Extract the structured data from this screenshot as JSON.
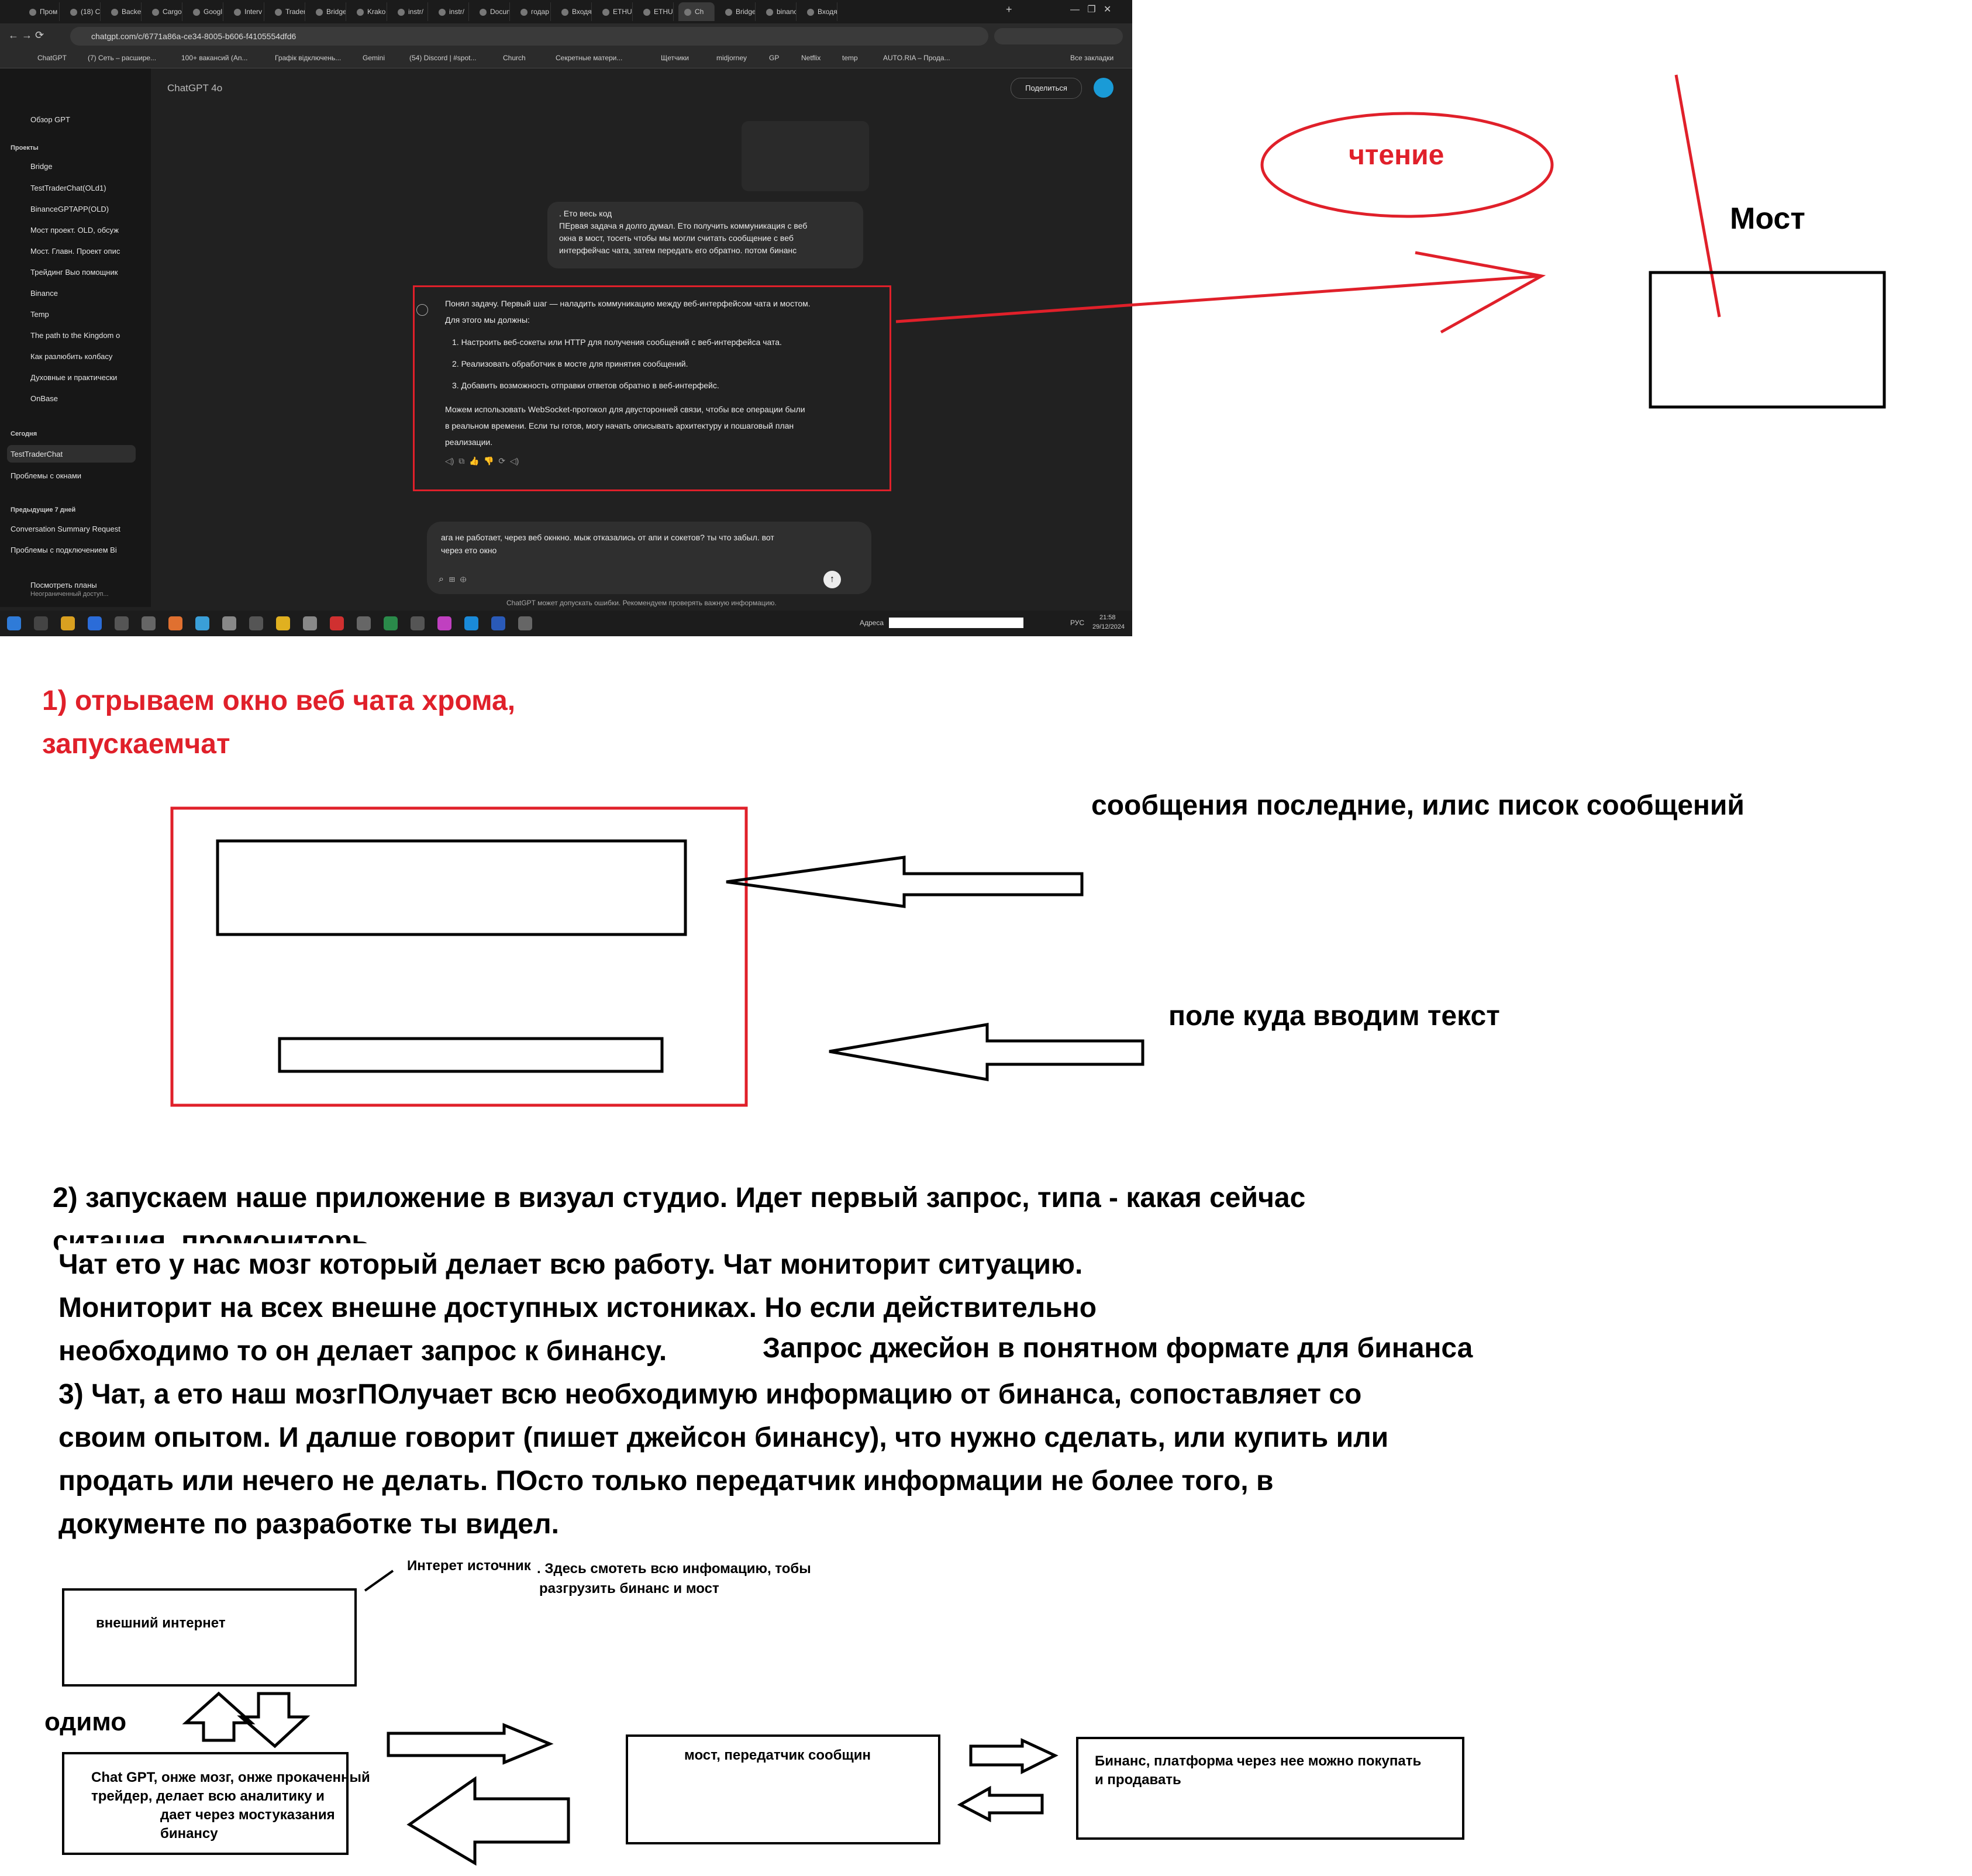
{
  "browser": {
    "tabs": [
      "Пром",
      "(18) C",
      "Backe",
      "Cargo",
      "Googl",
      "Interv",
      "Trader",
      "Bridge",
      "Krako",
      "instr/",
      "instr/",
      "Docun",
      "годар",
      "Входя",
      "ETHUS",
      "ETHUS",
      "Ch",
      "Bridge",
      "binanc",
      "Входя"
    ],
    "url": "chatgpt.com/c/6771a86a-ce34-8005-b606-f4105554dfd6",
    "bookmarks": [
      "ChatGPT",
      "(7) Сеть – расшире...",
      "100+ вакансий (An...",
      "Графік відключень...",
      "Gemini",
      "(54) Discord | #spot...",
      "Church",
      "Секретные матери...",
      "Щетчики",
      "midjorney",
      "GP",
      "Netflix",
      "temp",
      "AUTO.RIA – Прода...",
      "Все закладки"
    ]
  },
  "chatgpt": {
    "model": "ChatGPT 4o",
    "share": "Поделиться",
    "explore": "Обзор GPT",
    "projects_heading": "Проекты",
    "sidebar": [
      "Bridge",
      "TestTraderChat(OLd1)",
      "BinanceGPTAPP(OLD)",
      "Мост проект. OLD, обсуж",
      "Мост. Главн. Проект опис",
      "Трейдинг Bыо помощник",
      "Binance",
      "Temp",
      "The path to the Kingdom o",
      "Как разлюбить колбасу",
      "Духовные и практически",
      "OnBase"
    ],
    "today_heading": "Сегодня",
    "today": [
      "TestTraderChat",
      "Проблемы с окнами"
    ],
    "week_heading": "Предыдущие 7 дней",
    "week": [
      "Conversation Summary Request",
      "Проблемы с подключением Bi"
    ],
    "plans": "Посмотреть планы",
    "plans_sub": "Неограниченный доступ...",
    "user_message": [
      ". Ето весь код",
      "ПЕрвая задача я долго думал. Ето получить коммуникация с веб",
      "окна в мост, тосеть чтобы мы могли считать сообщение с веб",
      "интерфейчас чата, затем передать его обратно. потом бинанс"
    ],
    "answer_intro": [
      "Понял задачу. Первый шаг — наладить коммуникацию между веб-интерфейсом чата и мостом.",
      "Для этого мы должны:"
    ],
    "answer_list": [
      "1.  Настроить веб-сокеты или HTTP для получения сообщений с веб-интерфейса чата.",
      "2.  Реализовать обработчик в мосте для принятия сообщений.",
      "3.  Добавить возможность отправки ответов обратно в веб-интерфейс."
    ],
    "answer_outro": [
      "Можем использовать WebSocket-протокол для двусторонней связи, чтобы все операции были",
      "в реальном времени. Если ты готов, могу начать описывать архитектуру и пошаговый план",
      "реализации."
    ],
    "composer_text": [
      "ага не работает, через веб окнкно. мыж отказались  от апи и сокетов? ты что забыл. вот",
      "через ето окно"
    ],
    "disclaimer": "ChatGPT может допускать ошибки. Рекомендуем проверять важную информацию.",
    "taskbar_address": "Адреса",
    "tray_lang": "РУС",
    "time": "21:58",
    "date": "29/12/2024"
  },
  "annotations": {
    "reading": "чтение",
    "bridge": "Мост",
    "step1": [
      "1)   отрываем окно веб чата хрома,",
      "запускаемчат"
    ],
    "messages_label": "сообщения последние, илис писок сообщений",
    "input_label": "поле куда вводим текст",
    "step2": [
      "2) запускаем наше приложение в визуал студио. Идет первый запрос, типа - какая сейчас",
      "ситация, промониторь."
    ],
    "chat_brain": [
      "Чат ето у нас мозг который делает всю работу. Чат мониторит ситуацию.",
      "Мониторит на всех внешне доступных истониках. Но если действительно",
      "необходимо то он делает запрос к бинансу."
    ],
    "json_request": "Запрос джесйон в понятном формате для бинанса",
    "step3": [
      "3) Чат, а ето наш мозгПОлучает всю необходимую информацию от бинанса, сопоставляет со",
      "своим опытом. И далше говорит (пишет джейсон бинансу), что нужно сделать, или купить или",
      "продать или нечего не делать. ПОсто только передатчик информации не более того,  в",
      "документе по разработке ты видел."
    ],
    "internet_source": "Интерет источник",
    "internet_note": [
      ". Здесь смотеть всю инфомацию, тобы",
      "разгрузить бинанс и мост"
    ],
    "fragment": "одимо",
    "box_internet": "внешний интернет",
    "box_chatgpt": [
      "Chat GPT, онже мозг, онже прокаченный",
      "трейдер,  делает всю аналитику и",
      "дает через мостуказания",
      "бинансу"
    ],
    "box_bridge": "мост, передатчик сообщин",
    "box_binance": [
      "Бинанс, платформа через нее можно покупать",
      "и продавать"
    ]
  }
}
